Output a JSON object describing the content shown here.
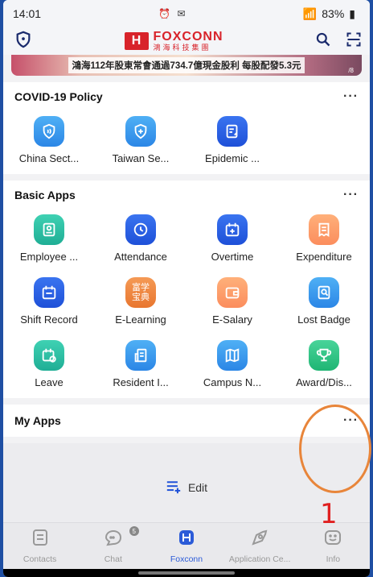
{
  "status": {
    "time": "14:01",
    "net": "Vo) LTE1",
    "battery": "83%"
  },
  "header": {
    "logo_mark": "H",
    "logo_en": "FOXCONN",
    "logo_zh": "鴻海科技集團"
  },
  "banner": {
    "text": "鴻海112年股東常會通過734.7億現金股利 每股配發5.3元",
    "page": "/8"
  },
  "covid": {
    "title": "COVID-19 Policy",
    "more": "···",
    "apps": [
      {
        "label": "China Sect...",
        "icon": "shield-signal-icon",
        "color": "#2b86e6"
      },
      {
        "label": "Taiwan Se...",
        "icon": "shield-plus-icon",
        "color": "#2b86e6"
      },
      {
        "label": "Epidemic ...",
        "icon": "document-edit-icon",
        "color": "#1e50d8"
      }
    ]
  },
  "basic": {
    "title": "Basic Apps",
    "more": "···",
    "apps": [
      {
        "label": "Employee ...",
        "icon": "id-card-icon"
      },
      {
        "label": "Attendance",
        "icon": "clock-icon"
      },
      {
        "label": "Overtime",
        "icon": "calendar-plus-icon"
      },
      {
        "label": "Expenditure",
        "icon": "receipt-icon"
      },
      {
        "label": "Shift Record",
        "icon": "calendar-icon"
      },
      {
        "label": "E-Learning",
        "icon": "learning-icon",
        "glyph": "富学\n宝典"
      },
      {
        "label": "E-Salary",
        "icon": "wallet-icon"
      },
      {
        "label": "Lost Badge",
        "icon": "badge-search-icon"
      },
      {
        "label": "Leave",
        "icon": "calendar-clock-icon"
      },
      {
        "label": "Resident I...",
        "icon": "building-icon"
      },
      {
        "label": "Campus N...",
        "icon": "map-icon"
      },
      {
        "label": "Award/Dis...",
        "icon": "trophy-icon"
      }
    ]
  },
  "myapps": {
    "title": "My Apps",
    "more": "···",
    "edit_label": "Edit"
  },
  "tabs": [
    {
      "label": "Contacts",
      "icon": "contacts-icon",
      "active": false
    },
    {
      "label": "Chat",
      "icon": "chat-icon",
      "active": false,
      "badge": "5"
    },
    {
      "label": "Foxconn",
      "icon": "foxconn-icon",
      "active": true
    },
    {
      "label": "Application Ce...",
      "icon": "application-center-icon",
      "active": false
    },
    {
      "label": "Info",
      "icon": "info-icon",
      "active": false
    }
  ],
  "annotation": {
    "number": "1",
    "color": "#e8853a"
  }
}
